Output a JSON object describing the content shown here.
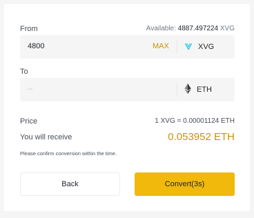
{
  "from": {
    "label": "From",
    "available_label": "Available:",
    "available_amount": "4887.497224",
    "available_unit": "XVG",
    "amount": "4800",
    "max_label": "MAX",
    "coin": "XVG",
    "coin_icon": "verge-icon",
    "coin_color": "#40ccea"
  },
  "to": {
    "label": "To",
    "placeholder": "--",
    "coin": "ETH",
    "coin_icon": "ethereum-icon"
  },
  "price": {
    "label": "Price",
    "value": "1 XVG = 0.00001124 ETH"
  },
  "receive": {
    "label": "You will receive",
    "value": "0.053952 ETH"
  },
  "note": "Please confirm conversion within the time.",
  "buttons": {
    "back": "Back",
    "convert": "Convert(3s)"
  },
  "colors": {
    "accent": "#f0b90b",
    "accent_text": "#c99400"
  }
}
